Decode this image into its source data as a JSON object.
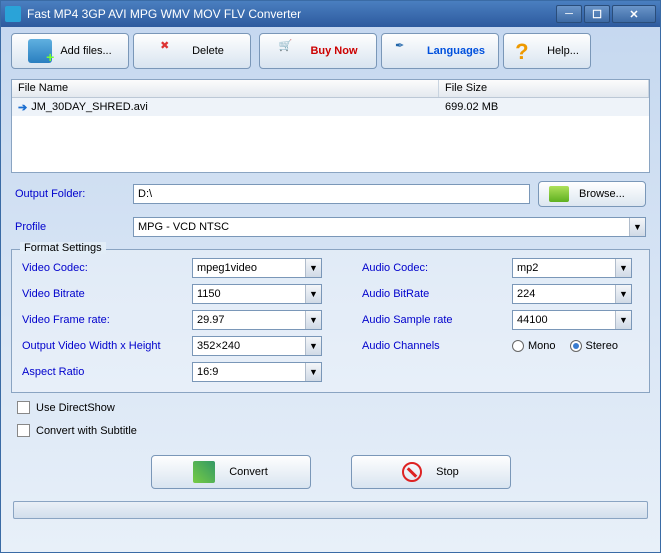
{
  "window": {
    "title": "Fast MP4 3GP AVI MPG WMV MOV FLV Converter"
  },
  "toolbar": {
    "add": "Add files...",
    "delete": "Delete",
    "buy": "Buy Now",
    "languages": "Languages",
    "help": "Help..."
  },
  "filelist": {
    "cols": {
      "name": "File Name",
      "size": "File Size"
    },
    "rows": [
      {
        "name": "JM_30DAY_SHRED.avi",
        "size": "699.02 MB"
      }
    ]
  },
  "output": {
    "folder_label": "Output Folder:",
    "folder_value": "D:\\",
    "browse": "Browse...",
    "profile_label": "Profile",
    "profile_value": "MPG - VCD NTSC"
  },
  "format": {
    "legend": "Format Settings",
    "video_codec_label": "Video Codec:",
    "video_codec": "mpeg1video",
    "video_bitrate_label": "Video Bitrate",
    "video_bitrate": "1150",
    "video_framerate_label": "Video Frame rate:",
    "video_framerate": "29.97",
    "video_size_label": "Output Video Width x Height",
    "video_size": "352×240",
    "aspect_label": "Aspect Ratio",
    "aspect": "16:9",
    "audio_codec_label": "Audio Codec:",
    "audio_codec": "mp2",
    "audio_bitrate_label": "Audio BitRate",
    "audio_bitrate": "224",
    "audio_sample_label": "Audio Sample rate",
    "audio_sample": "44100",
    "audio_channels_label": "Audio Channels",
    "mono": "Mono",
    "stereo": "Stereo"
  },
  "checks": {
    "directshow": "Use DirectShow",
    "subtitle": "Convert with Subtitle"
  },
  "actions": {
    "convert": "Convert",
    "stop": "Stop"
  }
}
